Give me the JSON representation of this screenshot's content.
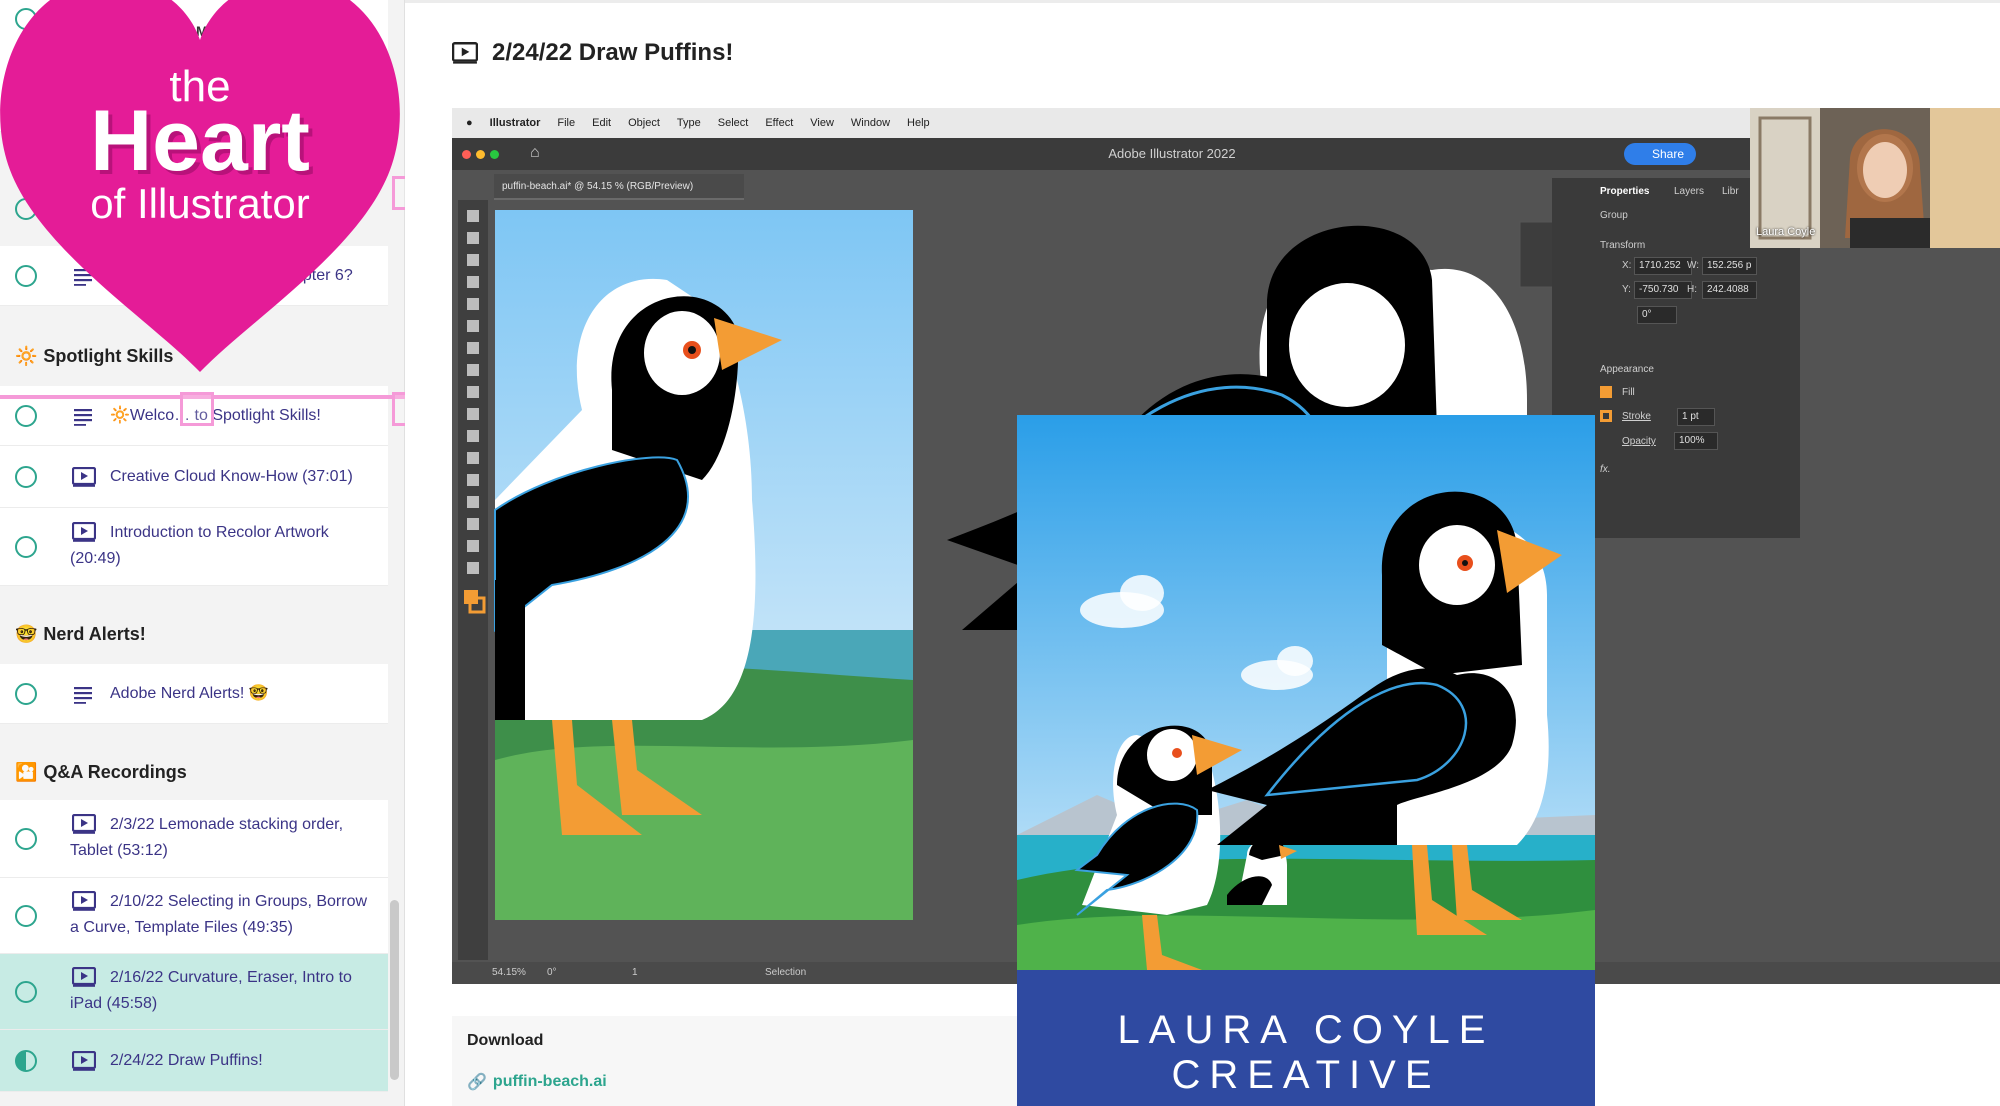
{
  "sidebar": {
    "header_partial": "COMP",
    "lessons_top": [
      {
        "label": "…apter 6?",
        "icon": "text-lines-icon"
      }
    ],
    "sections": [
      {
        "emoji": "🔆",
        "title": "Spotlight Skills",
        "lessons": [
          {
            "label": "🔆Welco… to Spotlight Skills!",
            "icon": "text-lines-icon"
          },
          {
            "label": "Creative Cloud Know-How (37:01)",
            "icon": "video-icon"
          },
          {
            "label": "Introduction to Recolor Artwork (20:49)",
            "icon": "video-icon"
          }
        ]
      },
      {
        "emoji": "🤓",
        "title": "Nerd Alerts!",
        "lessons": [
          {
            "label": "Adobe Nerd Alerts! 🤓",
            "icon": "text-lines-icon"
          }
        ]
      },
      {
        "emoji": "🎦",
        "title": "Q&A Recordings",
        "lessons": [
          {
            "label": "2/3/22 Lemonade stacking order, Tablet (53:12)",
            "icon": "video-icon"
          },
          {
            "label": "2/10/22 Selecting in Groups, Borrow a Curve, Template Files (49:35)",
            "icon": "video-icon"
          },
          {
            "label": "2/16/22 Curvature, Eraser, Intro to iPad (45:58)",
            "icon": "video-icon"
          },
          {
            "label": "2/24/22 Draw Puffins!",
            "icon": "video-icon"
          }
        ]
      }
    ]
  },
  "overlay": {
    "line1": "the",
    "line2": "Heart",
    "line3": "of Illustrator",
    "heart_color": "#e41c97"
  },
  "lesson": {
    "title": "2/24/22 Draw Puffins!",
    "icon": "video-icon"
  },
  "video": {
    "menu": [
      "Illustrator",
      "File",
      "Edit",
      "Object",
      "Type",
      "Select",
      "Effect",
      "View",
      "Window",
      "Help"
    ],
    "app_title": "Adobe Illustrator 2022",
    "share_label": "Share",
    "doc_tab": "puffin-beach.ai* @ 54.15 % (RGB/Preview)",
    "panel": {
      "tabs": [
        "Properties",
        "Layers",
        "Libr"
      ],
      "group": "Group",
      "transform": "Transform",
      "x_label": "X:",
      "x_value": "1710.252",
      "y_label": "Y:",
      "y_value": "-750.730",
      "w_label": "W:",
      "w_value": "152.256 p",
      "h_label": "H:",
      "h_value": "242.4088",
      "angle": "0°",
      "appearance": "Appearance",
      "fill": "Fill",
      "stroke": "Stroke",
      "stroke_value": "1 pt",
      "opacity": "Opacity",
      "opacity_value": "100%",
      "fx": "fx."
    },
    "status": {
      "zoom": "54.15%",
      "angle": "0°",
      "artboard": "1",
      "tool": "Selection"
    },
    "webcam_name": "Laura Coyle"
  },
  "brand": {
    "text": "LAURA COYLE CREATIVE",
    "color": "#2f4aa1"
  },
  "download": {
    "heading": "Download",
    "file": "puffin-beach.ai"
  }
}
